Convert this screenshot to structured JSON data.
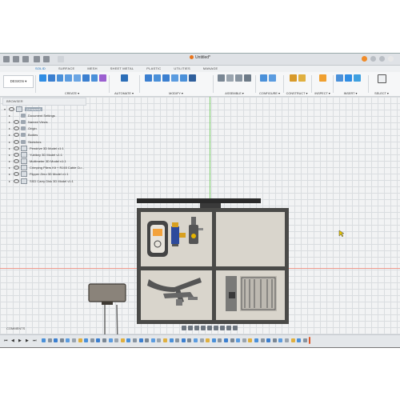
{
  "window": {
    "title": "Untitled*"
  },
  "tabs": [
    "SOLID",
    "SURFACE",
    "MESH",
    "SHEET METAL",
    "PLASTIC",
    "UTILITIES",
    "MANAGE"
  ],
  "active_tab": "SOLID",
  "ribbon": {
    "workspace_button": "DESIGN ▾",
    "groups": [
      "CREATE ▾",
      "AUTOMATE ▾",
      "MODIFY ▾",
      "ASSEMBLE ▾",
      "CONFIGURE ▾",
      "CONSTRUCT ▾",
      "INSPECT ▾",
      "INSERT ▾",
      "SELECT ▾"
    ]
  },
  "browser": {
    "header": "BROWSER",
    "root": "(Unsaved)",
    "items": [
      "Document Settings",
      "Named Views",
      "Origin",
      "Bodies",
      "Sketches",
      "Pendrive 3D Model v1:1",
      "Yubikey 3D Model v1:1",
      "Multimeter 3D Model v1:1",
      "Crimping Pliers Kit + RJ45 Cable Cu…",
      "Flipper Zero 3D Model v1:1",
      "SSD Carry Disk 3D Model v1:1"
    ]
  },
  "comments_label": "COMMENTS",
  "colors": {
    "accent": "#0a64b4",
    "x_axis": "#ef9a8c",
    "y_axis": "#7ccf6a"
  },
  "icons": [
    "design-icon",
    "sketch-icon",
    "extrude-icon",
    "revolve-icon",
    "fillet-icon",
    "joint-icon",
    "plane-icon",
    "measure-icon",
    "insert-image-icon",
    "select-arrow-icon",
    "eye-icon",
    "folder-icon",
    "component-icon",
    "play-icon",
    "orbit-icon",
    "pan-icon",
    "zoom-icon"
  ]
}
